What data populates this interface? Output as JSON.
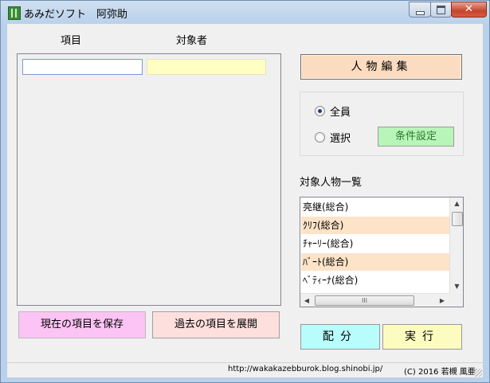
{
  "window": {
    "title": "あみだソフト　阿弥助",
    "min_glyph": "",
    "close_glyph": "✕"
  },
  "columns": {
    "item_header": "項目",
    "person_header": "対象者"
  },
  "entry": {
    "item_value": "",
    "person_value": ""
  },
  "buttons": {
    "edit_persons": "人物編集",
    "conditions": "条件設定",
    "save_items": "現在の項目を保存",
    "expand_items": "過去の項目を展開",
    "distribute": "配分",
    "execute": "実行"
  },
  "target_options": {
    "all_label": "全員",
    "select_label": "選択",
    "selected": "all"
  },
  "person_list": {
    "title": "対象人物一覧",
    "items": [
      {
        "label": "亮継(総合)",
        "highlighted": false
      },
      {
        "label": "ｸﾘﾌ(総合)",
        "highlighted": true
      },
      {
        "label": "ﾁｬｰﾘｰ(総合)",
        "highlighted": false
      },
      {
        "label": "ﾊﾞｰﾄ(総合)",
        "highlighted": true
      },
      {
        "label": "ﾍﾞﾃｨｰﾅ(総合)",
        "highlighted": false
      }
    ],
    "hscroll_grip": "III"
  },
  "status": {
    "url": "http://wakakazebburok.blog.shinobi.jp/",
    "copyright": "(C) 2016 若槻 風亜"
  },
  "colors": {
    "highlight_row": "#fde3c8",
    "title_gradient": "#b9d1ea"
  }
}
